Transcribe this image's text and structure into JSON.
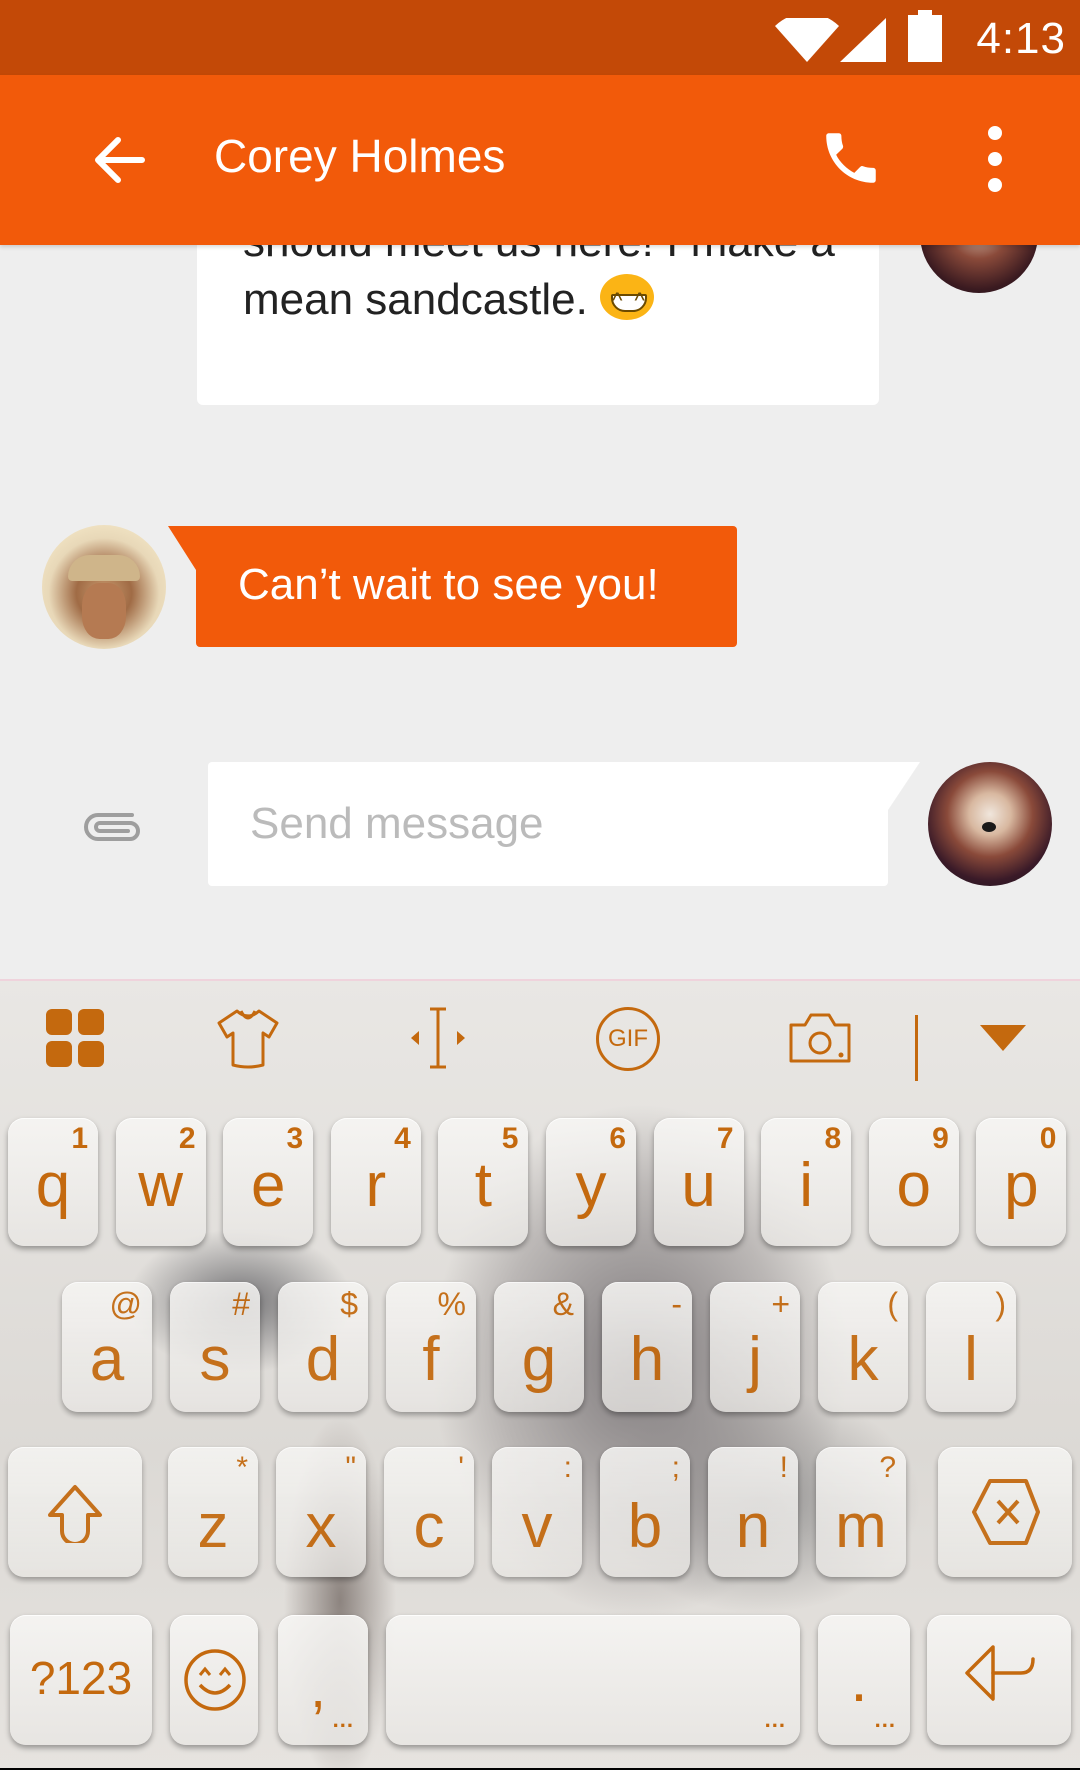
{
  "status_bar": {
    "time": "4:13",
    "icons": [
      "wifi-icon",
      "cell-signal-icon",
      "battery-icon"
    ]
  },
  "app_bar": {
    "title": "Corey Holmes",
    "back_icon": "arrow-left-icon",
    "call_icon": "phone-icon",
    "more_icon": "more-vert-icon"
  },
  "colors": {
    "status_bar": "#c34907",
    "app_bar": "#f25a0a",
    "outgoing_bubble": "#f25a0a",
    "chat_background": "#eeeeee",
    "keyboard_accent": "#c4690e"
  },
  "messages": [
    {
      "direction": "incoming",
      "text": "should meet us here! I make a mean sandcastle.",
      "emoji": "grinning-face"
    },
    {
      "direction": "outgoing",
      "text": "Can’t wait to see you!"
    }
  ],
  "composer": {
    "placeholder": "Send message",
    "value": "",
    "attach_icon": "paperclip-icon"
  },
  "keyboard": {
    "toolbar": [
      "apps-grid-icon",
      "theme-shirt-icon",
      "cursor-move-icon",
      "gif-icon",
      "camera-icon",
      "collapse-triangle-icon"
    ],
    "gif_label": "GIF",
    "row1": [
      {
        "key": "q",
        "hint": "1"
      },
      {
        "key": "w",
        "hint": "2"
      },
      {
        "key": "e",
        "hint": "3"
      },
      {
        "key": "r",
        "hint": "4"
      },
      {
        "key": "t",
        "hint": "5"
      },
      {
        "key": "y",
        "hint": "6"
      },
      {
        "key": "u",
        "hint": "7"
      },
      {
        "key": "i",
        "hint": "8"
      },
      {
        "key": "o",
        "hint": "9"
      },
      {
        "key": "p",
        "hint": "0"
      }
    ],
    "row2": [
      {
        "key": "a",
        "hint": "@"
      },
      {
        "key": "s",
        "hint": "#"
      },
      {
        "key": "d",
        "hint": "$"
      },
      {
        "key": "f",
        "hint": "%"
      },
      {
        "key": "g",
        "hint": "&"
      },
      {
        "key": "h",
        "hint": "-"
      },
      {
        "key": "j",
        "hint": "+"
      },
      {
        "key": "k",
        "hint": "("
      },
      {
        "key": "l",
        "hint": ")"
      }
    ],
    "row3": [
      {
        "key": "z",
        "hint": "*"
      },
      {
        "key": "x",
        "hint": "\""
      },
      {
        "key": "c",
        "hint": "'"
      },
      {
        "key": "v",
        "hint": ":"
      },
      {
        "key": "b",
        "hint": ";"
      },
      {
        "key": "n",
        "hint": "!"
      },
      {
        "key": "m",
        "hint": "?"
      }
    ],
    "shift_icon": "shift-arrow-icon",
    "delete_icon": "backspace-icon",
    "symbols_label": "?123",
    "emoji_icon": "smiley-icon",
    "comma_label": ",",
    "period_label": ".",
    "more_dots": "...",
    "enter_icon": "enter-arrow-icon"
  }
}
